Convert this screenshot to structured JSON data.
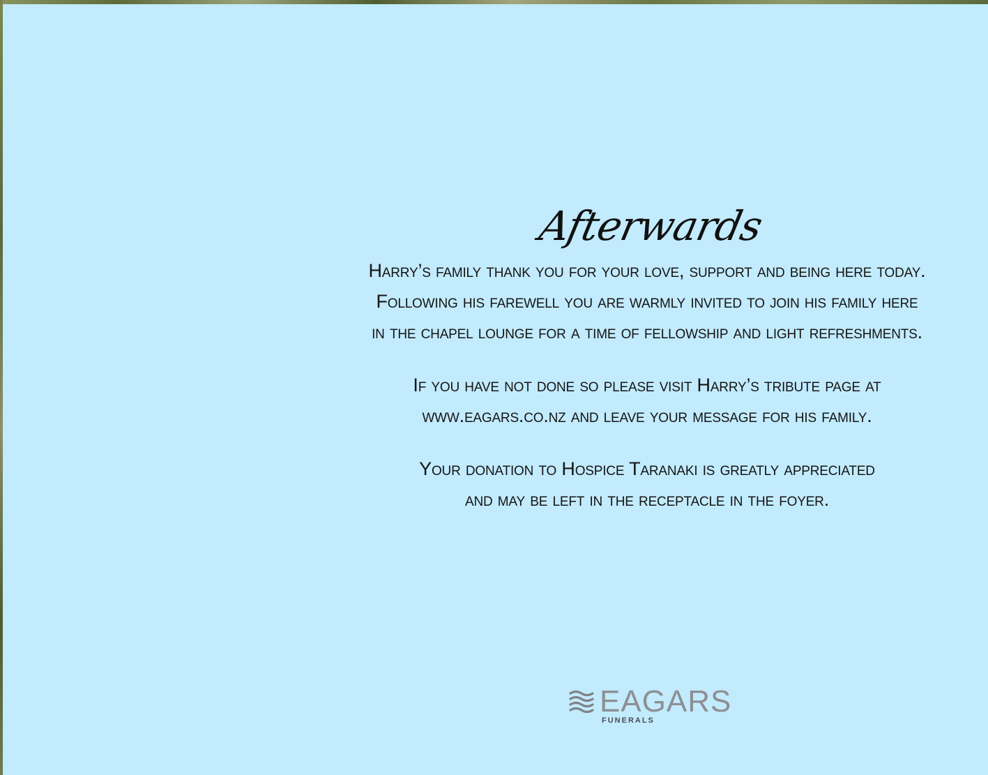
{
  "heading": "Afterwards",
  "paragraphs": [
    [
      "Harry’s family thank you for  your love, support and being here today.",
      "Following his farewell you are warmly invited to join his family here",
      "in the chapel lounge for a time of fellowship and light refreshments."
    ],
    [
      "If you have not done so please visit Harry’s tribute page at",
      "www.eagars.co.nz and leave your message for his family."
    ],
    [
      "Your donation to Hospice Taranaki is greatly appreciated",
      "and may be left in the receptacle in the foyer."
    ]
  ],
  "logo": {
    "name": "EAGARS",
    "sub": "FUNERALS",
    "icon": "wave-lines-icon"
  },
  "colors": {
    "panel": "#c2ebfd",
    "text": "#141414",
    "logo_grey": "#8d8f93",
    "logo_dark": "#4b4c50"
  }
}
